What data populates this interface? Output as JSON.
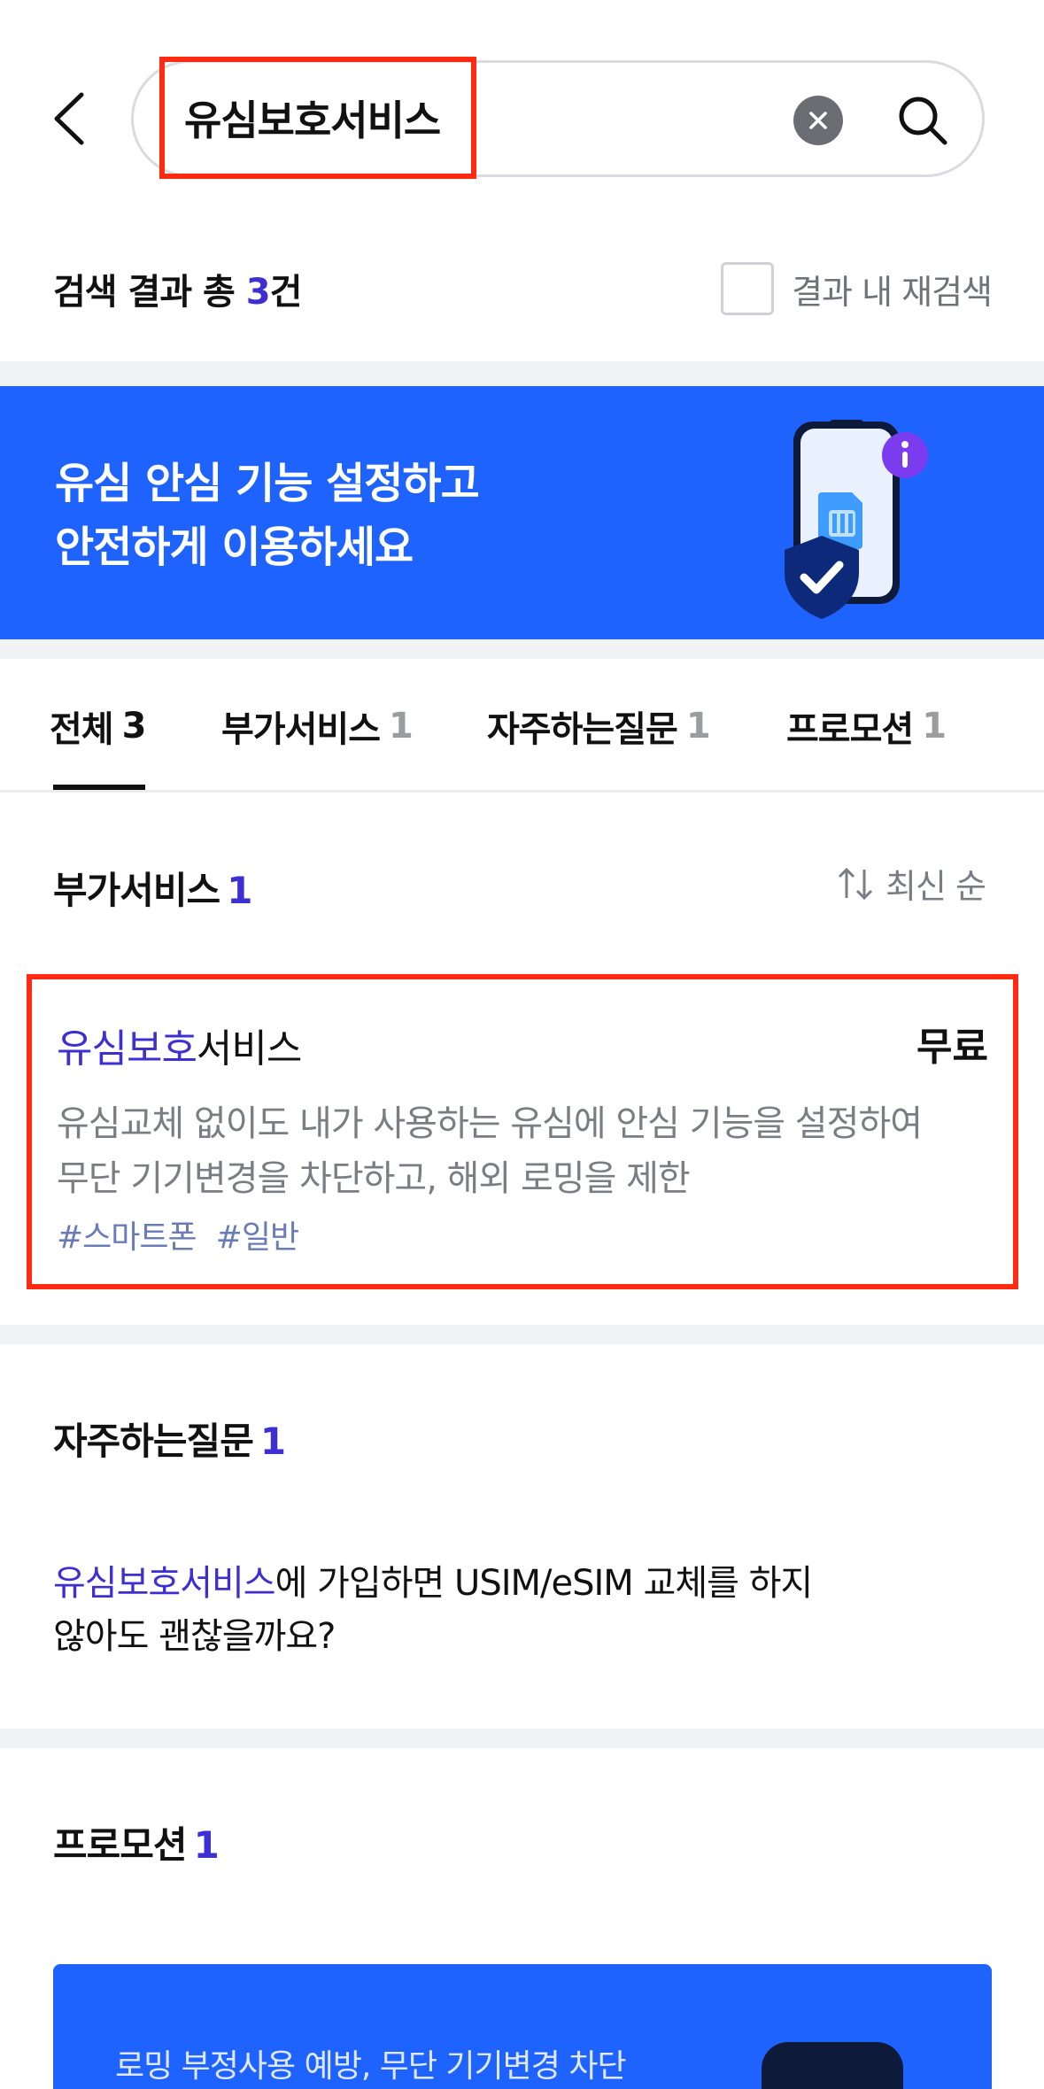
{
  "header": {
    "search_value": "유심보호서비스"
  },
  "results": {
    "summary_prefix": "검색 결과 총 ",
    "summary_count": "3",
    "summary_suffix": "건",
    "refine_label": "결과 내 재검색"
  },
  "banner": {
    "line1": "유심 안심 기능 설정하고",
    "line2": "안전하게 이용하세요"
  },
  "tabs": [
    {
      "label": "전체",
      "count": "3",
      "active": true
    },
    {
      "label": "부가서비스",
      "count": "1",
      "active": false
    },
    {
      "label": "자주하는질문",
      "count": "1",
      "active": false
    },
    {
      "label": "프로모션",
      "count": "1",
      "active": false
    }
  ],
  "addon_section": {
    "title": "부가서비스",
    "count": "1",
    "sort_label": "최신 순",
    "item": {
      "title_highlight": "유심보호",
      "title_rest": "서비스",
      "price": "무료",
      "desc_line1": "유심교체 없이도 내가 사용하는 유심에 안심 기능을 설정하여",
      "desc_line2": "무단 기기변경을 차단하고, 해외 로밍을 제한",
      "tags": [
        "#스마트폰",
        "#일반"
      ]
    }
  },
  "faq_section": {
    "title": "자주하는질문",
    "count": "1",
    "question_highlight": "유심보호서비스",
    "question_rest_line1": "에 가입하면 USIM/eSIM 교체를 하지",
    "question_line2": "않아도 괜찮을까요?"
  },
  "promo_section": {
    "title": "프로모션",
    "count": "1",
    "card_text": "로밍 부정사용 예방, 무단 기기변경 차단"
  },
  "colors": {
    "accent": "#3d2fd2",
    "banner_blue": "#1f63ff",
    "highlight_box": "#ff2a12"
  }
}
